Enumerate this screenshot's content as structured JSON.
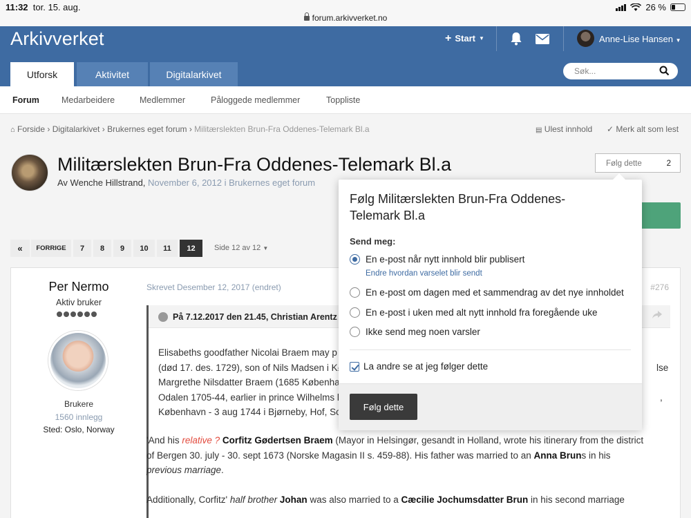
{
  "status_bar": {
    "time": "11:32",
    "date": "tor. 15. aug.",
    "battery": "26 %",
    "url": "forum.arkivverket.no"
  },
  "header": {
    "logo": "Arkivverket",
    "start_label": "Start",
    "user_name": "Anne-Lise Hansen",
    "tabs": [
      "Utforsk",
      "Aktivitet",
      "Digitalarkivet"
    ],
    "search_placeholder": "Søk..."
  },
  "subnav": [
    "Forum",
    "Medarbeidere",
    "Medlemmer",
    "Påloggede medlemmer",
    "Toppliste"
  ],
  "breadcrumb": {
    "items": [
      "Forside",
      "Digitalarkivet",
      "Brukernes eget forum",
      "Militærslekten Brun-Fra Oddenes-Telemark Bl.a"
    ],
    "unread": "Ulest innhold",
    "mark_read": "Merk alt som lest"
  },
  "topic": {
    "title": "Militærslekten Brun-Fra Oddenes-Telemark Bl.a",
    "by": "Av Wenche Hillstrand,",
    "date": "November 6, 2012 i Brukernes eget forum",
    "follow_label": "Følg dette",
    "follow_count": "2"
  },
  "pagination": {
    "prev": "FORRIGE",
    "pages": [
      "7",
      "8",
      "9",
      "10",
      "11",
      "12"
    ],
    "current": "12",
    "info": "Side 12 av 12"
  },
  "post": {
    "author": "Per Nermo",
    "rank": "Aktiv bruker",
    "group": "Brukere",
    "count": "1560 innlegg",
    "location": "Sted: Oslo, Norway",
    "meta": "Skrevet Desember 12, 2017 (endret)",
    "number": "#276",
    "quote_header": "På 7.12.2017 den 21.45, Christian Arentz s",
    "quote_lines": [
      "Elisabeths goodfather Nicolai Braem may p",
      "(død 17. des. 1729), son of Nils Madsen i Kø",
      "Margrethe Nilsdatter Braem (1685 Københa",
      "Odalen 1705-44, earlier in prince Wilhelms li",
      "København - 3 aug 1744 i Bjørneby, Hof, So"
    ],
    "quote_tail": [
      "lse",
      ","
    ],
    "p2_l1_a": "'And his ",
    "p2_l1_b": "relative ?",
    "p2_l1_c": " Corfitz Gødertsen Braem",
    "p2_l1_d": " (Mayor in Helsingør, gesandt in Holland, wrote his itinerary from  the district",
    "p2_l2_a": "of  Bergen 30. july - 30. sept 1673 (Norske Magasin II s. 459-88). His father was married to an ",
    "p2_l2_b": "Anna Brun",
    "p2_l2_c": "s in his",
    "p2_l3": "previous marriage",
    "p2_l3_end": ".",
    "p3_a": "Additionally, Corfitz' ",
    "p3_b": "half brother",
    "p3_c": " Johan",
    "p3_d": " was also married to a ",
    "p3_e": "Cæcilie Jochumsdatter Brun",
    "p3_f": " in his second marriage"
  },
  "popover": {
    "title": "Følg Militærslekten Brun-Fra Oddenes-Telemark Bl.a",
    "send_label": "Send meg:",
    "options": [
      "En e-post når nytt innhold blir publisert",
      "En e-post om dagen med et sammendrag av det nye innholdet",
      "En e-post i uken med alt nytt innhold fra foregående uke",
      "Ikke send meg noen varsler"
    ],
    "selected_option": 0,
    "change_link": "Endre hvordan varselet blir sendt",
    "anon_label": "La andre se at jeg følger dette",
    "anon_checked": true,
    "submit": "Følg dette"
  },
  "colors": {
    "header_bg": "#3e6ba2",
    "tab_inactive": "#5681b5",
    "accent_green": "#4ea37a",
    "link": "#3e6ba2"
  }
}
